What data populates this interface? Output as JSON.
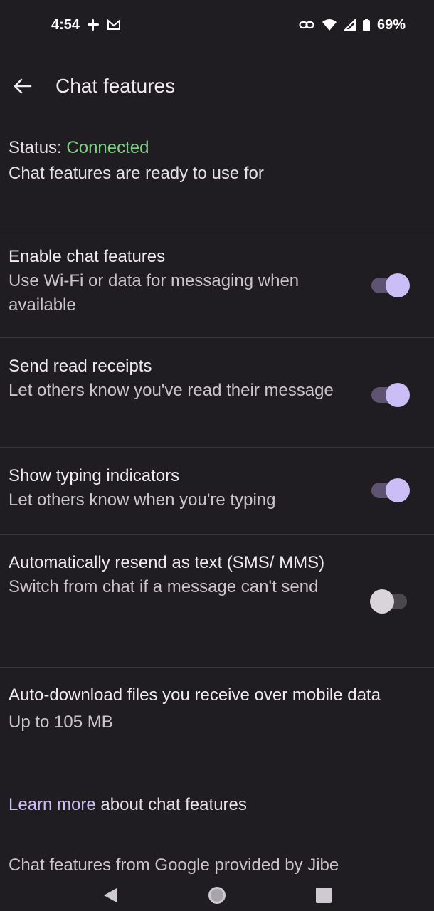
{
  "status_bar": {
    "time": "4:54",
    "battery": "69%"
  },
  "header": {
    "title": "Chat features"
  },
  "status": {
    "label": "Status:",
    "value": "Connected",
    "description": "Chat features are ready to use for"
  },
  "settings": [
    {
      "title": "Enable chat features",
      "subtitle": "Use Wi-Fi or data for messaging when available",
      "enabled": true
    },
    {
      "title": "Send read receipts",
      "subtitle": "Let others know you've read their message",
      "enabled": true
    },
    {
      "title": "Show typing indicators",
      "subtitle": "Let others know when you're typing",
      "enabled": true
    },
    {
      "title": "Automatically resend as text (SMS/ MMS)",
      "subtitle": "Switch from chat if a message can't send",
      "enabled": false
    }
  ],
  "auto_download": {
    "title": "Auto-download files you receive over mobile data",
    "value": "Up to 105 MB"
  },
  "footer": {
    "learn_more_link": "Learn more",
    "learn_more_rest": " about chat features",
    "provider": "Chat features from Google provided by Jibe"
  },
  "colors": {
    "background": "#1f1d22",
    "accent": "#cbbdf6",
    "connected": "#7fcf80"
  }
}
